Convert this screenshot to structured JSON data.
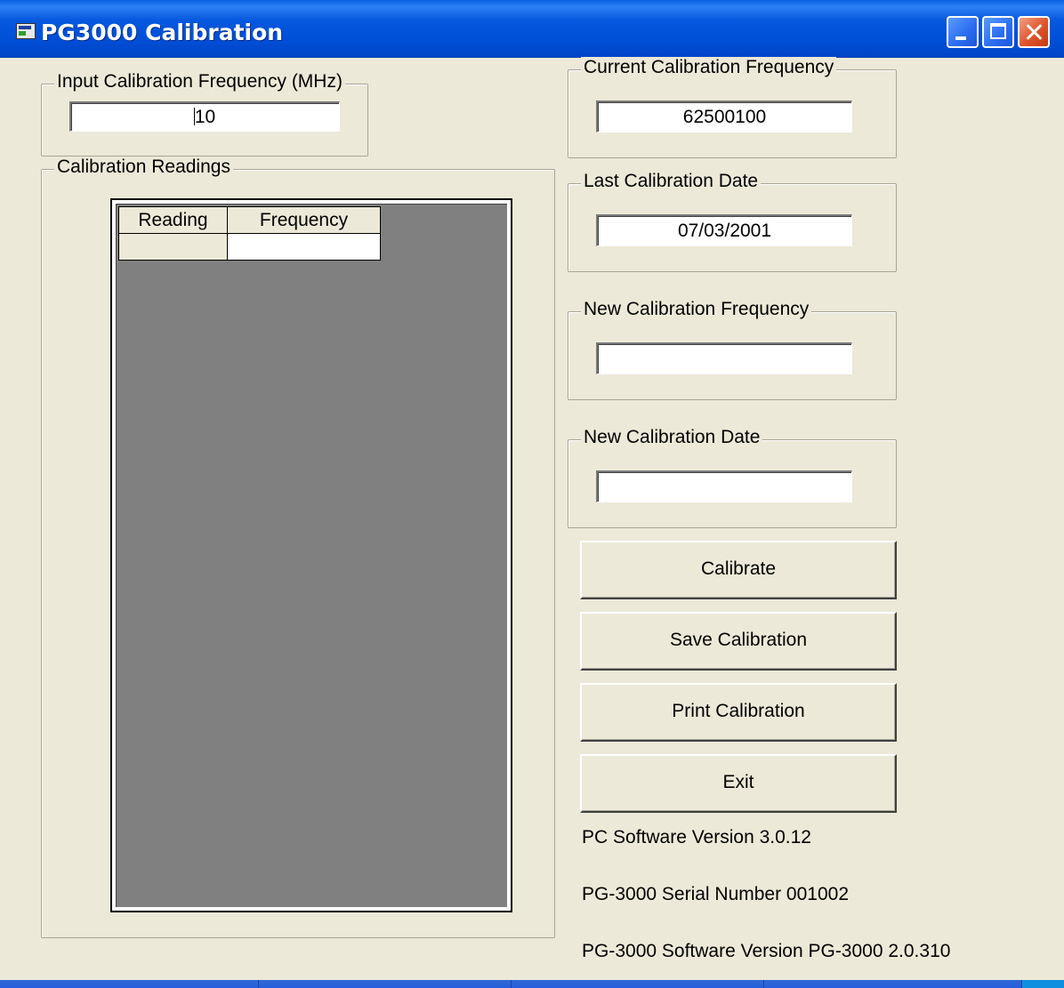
{
  "window": {
    "title": "PG3000 Calibration",
    "icon": "app-window-icon"
  },
  "title_buttons": [
    "minimize-icon",
    "maximize-icon",
    "close-icon"
  ],
  "input_group": {
    "legend": "Input Calibration Frequency (MHz)",
    "value": "10"
  },
  "readings_group": {
    "legend": "Calibration Readings",
    "columns": [
      "Reading",
      "Frequency"
    ],
    "rows": [
      [
        "",
        ""
      ]
    ]
  },
  "current_freq": {
    "legend": "Current Calibration Frequency",
    "value": "62500100"
  },
  "last_date": {
    "legend": "Last Calibration Date",
    "value": "07/03/2001"
  },
  "new_freq": {
    "legend": "New Calibration Frequency",
    "value": ""
  },
  "new_date": {
    "legend": "New Calibration Date",
    "value": ""
  },
  "buttons": {
    "calibrate": "Calibrate",
    "save": "Save Calibration",
    "print": "Print Calibration",
    "exit": "Exit"
  },
  "info": {
    "pc_version": "PC Software Version 3.0.12",
    "serial": "PG-3000 Serial Number 001002",
    "device_version": "PG-3000 Software Version PG-3000 2.0.310"
  },
  "colors": {
    "titlebar": "#0054E3",
    "window_bg": "#ECE9D8",
    "grid_bg": "#808080",
    "close_button": "#E0522A"
  }
}
